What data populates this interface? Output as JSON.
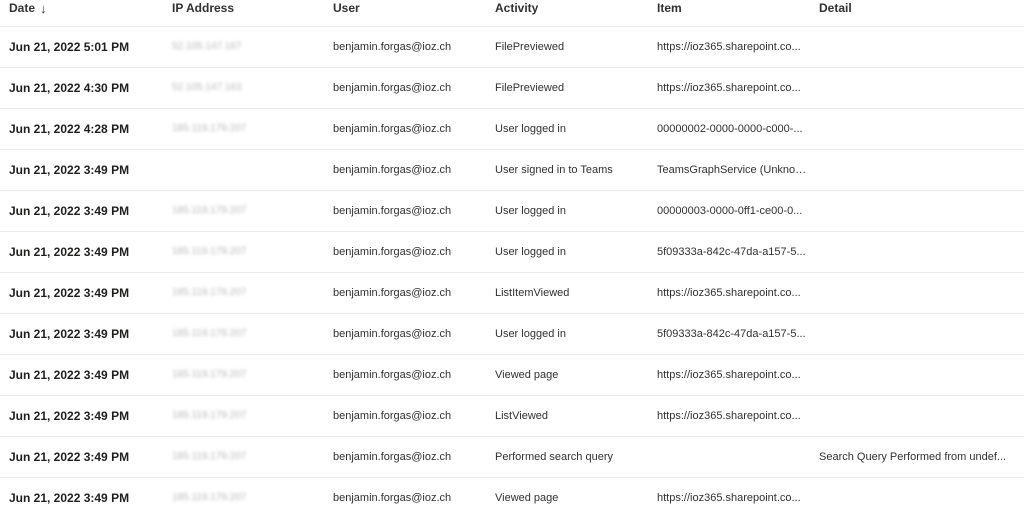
{
  "header": {
    "date": "Date",
    "ip": "IP Address",
    "user": "User",
    "activity": "Activity",
    "item": "Item",
    "detail": "Detail"
  },
  "rows": [
    {
      "date": "Jun 21, 2022 5:01 PM",
      "ip": "52.105.147.167",
      "user": "benjamin.forgas@ioz.ch",
      "activity": "FilePreviewed",
      "item": "https://ioz365.sharepoint.co...",
      "detail": ""
    },
    {
      "date": "Jun 21, 2022 4:30 PM",
      "ip": "52.105.147.163",
      "user": "benjamin.forgas@ioz.ch",
      "activity": "FilePreviewed",
      "item": "https://ioz365.sharepoint.co...",
      "detail": ""
    },
    {
      "date": "Jun 21, 2022 4:28 PM",
      "ip": "185.119.179.207",
      "user": "benjamin.forgas@ioz.ch",
      "activity": "User logged in",
      "item": "00000002-0000-0000-c000-...",
      "detail": ""
    },
    {
      "date": "Jun 21, 2022 3:49 PM",
      "ip": "",
      "user": "benjamin.forgas@ioz.ch",
      "activity": "User signed in to Teams",
      "item": "TeamsGraphService (Unknow...",
      "detail": ""
    },
    {
      "date": "Jun 21, 2022 3:49 PM",
      "ip": "185.119.179.207",
      "user": "benjamin.forgas@ioz.ch",
      "activity": "User logged in",
      "item": "00000003-0000-0ff1-ce00-0...",
      "detail": ""
    },
    {
      "date": "Jun 21, 2022 3:49 PM",
      "ip": "185.119.179.207",
      "user": "benjamin.forgas@ioz.ch",
      "activity": "User logged in",
      "item": "5f09333a-842c-47da-a157-5...",
      "detail": ""
    },
    {
      "date": "Jun 21, 2022 3:49 PM",
      "ip": "185.119.179.207",
      "user": "benjamin.forgas@ioz.ch",
      "activity": "ListItemViewed",
      "item": "https://ioz365.sharepoint.co...",
      "detail": ""
    },
    {
      "date": "Jun 21, 2022 3:49 PM",
      "ip": "185.119.179.207",
      "user": "benjamin.forgas@ioz.ch",
      "activity": "User logged in",
      "item": "5f09333a-842c-47da-a157-5...",
      "detail": ""
    },
    {
      "date": "Jun 21, 2022 3:49 PM",
      "ip": "185.119.179.207",
      "user": "benjamin.forgas@ioz.ch",
      "activity": "Viewed page",
      "item": "https://ioz365.sharepoint.co...",
      "detail": ""
    },
    {
      "date": "Jun 21, 2022 3:49 PM",
      "ip": "185.119.179.207",
      "user": "benjamin.forgas@ioz.ch",
      "activity": "ListViewed",
      "item": "https://ioz365.sharepoint.co...",
      "detail": ""
    },
    {
      "date": "Jun 21, 2022 3:49 PM",
      "ip": "185.119.179.207",
      "user": "benjamin.forgas@ioz.ch",
      "activity": "Performed search query",
      "item": "",
      "detail": "Search Query Performed from undef..."
    },
    {
      "date": "Jun 21, 2022 3:49 PM",
      "ip": "185.119.179.207",
      "user": "benjamin.forgas@ioz.ch",
      "activity": "Viewed page",
      "item": "https://ioz365.sharepoint.co...",
      "detail": ""
    }
  ]
}
